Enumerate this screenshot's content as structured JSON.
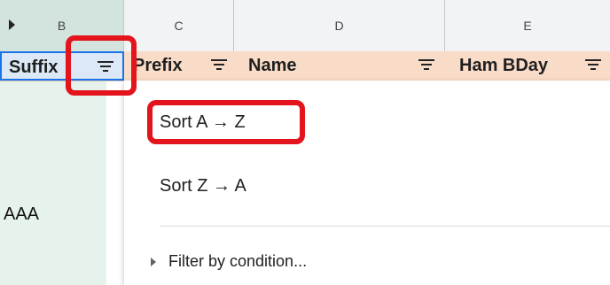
{
  "columns": {
    "b": "B",
    "c": "C",
    "d": "D",
    "e": "E"
  },
  "headers": {
    "suffix": "Suffix",
    "prefix": "Prefix",
    "name": "Name",
    "ham_bday": "Ham BDay"
  },
  "cells": {
    "row_aaa": "AAA"
  },
  "menu": {
    "sort_az": "Sort A → Z",
    "sort_za": "Sort Z → A",
    "filter_by_condition": "Filter by condition..."
  },
  "colors": {
    "highlight": "#e3141b",
    "header_bg": "#f8dcc7",
    "selection_border": "#1a73e8"
  }
}
